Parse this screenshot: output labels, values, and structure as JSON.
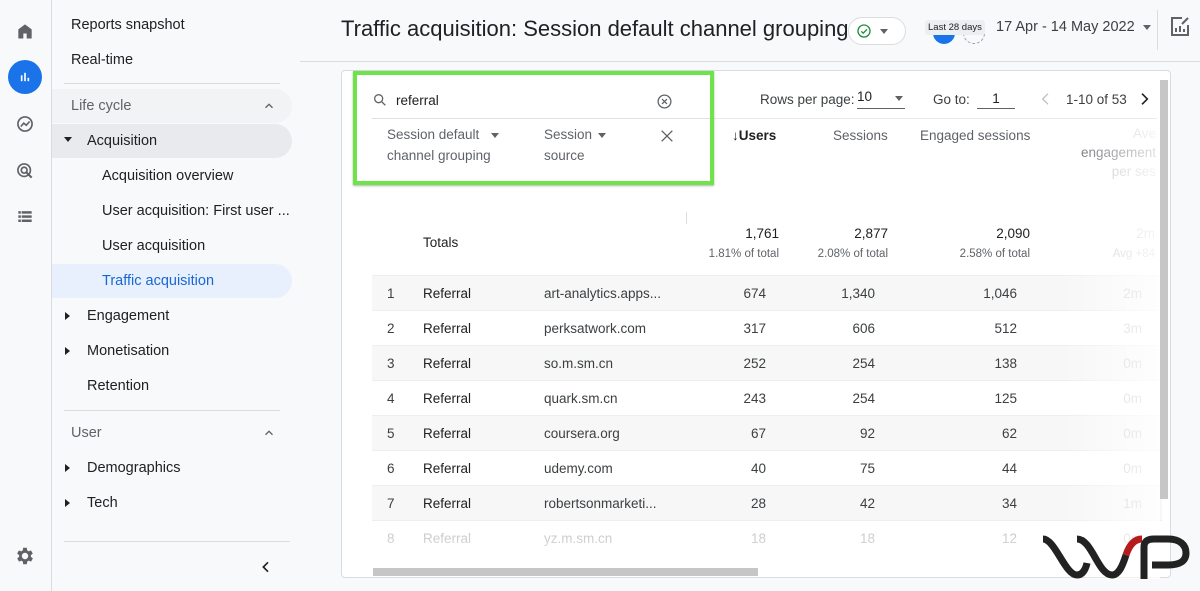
{
  "rail": {
    "icons": [
      "home-icon",
      "reports-icon",
      "explore-icon",
      "advertising-icon",
      "configure-icon"
    ],
    "settings_icon": "gear-icon"
  },
  "nav": {
    "reports_snapshot": "Reports snapshot",
    "realtime": "Real-time",
    "life_cycle": "Life cycle",
    "acquisition": "Acquisition",
    "acquisition_overview": "Acquisition overview",
    "user_acquisition_first": "User acquisition: First user ...",
    "user_acquisition": "User acquisition",
    "traffic_acquisition": "Traffic acquisition",
    "engagement": "Engagement",
    "monetisation": "Monetisation",
    "retention": "Retention",
    "user": "User",
    "demographics": "Demographics",
    "tech": "Tech"
  },
  "header": {
    "title": "Traffic acquisition: Session default channel grouping",
    "date_badge": "Last 28 days",
    "date_range": "17 Apr - 14 May 2022",
    "accent_color": "#1a73e8",
    "status_color": "#1e8e3e"
  },
  "table": {
    "search_value": "referral",
    "dimension_1": "Session default channel grouping",
    "dimension_1_line1": "Session default",
    "dimension_1_line2": "channel grouping",
    "dimension_2_line1": "Session",
    "dimension_2_line2": "source",
    "rows_per_page_label": "Rows per page:",
    "rows_per_page_value": "10",
    "goto_label": "Go to:",
    "goto_value": "1",
    "page_range": "1-10 of 53",
    "columns": {
      "users": "Users",
      "sessions": "Sessions",
      "engaged_sessions": "Engaged sessions",
      "avg_engagement_l1": "Ave",
      "avg_engagement_l2": "engagement",
      "avg_engagement_l3": "per ses"
    },
    "totals": {
      "label": "Totals",
      "users": "1,761",
      "users_pct": "1.81% of total",
      "sessions": "2,877",
      "sessions_pct": "2.08% of total",
      "engaged": "2,090",
      "engaged_pct": "2.58% of total",
      "avg": "2m",
      "avg_sub": "Avg +84"
    },
    "rows": [
      {
        "idx": "1",
        "channel": "Referral",
        "source": "art-analytics.apps...",
        "users": "674",
        "sessions": "1,340",
        "engaged": "1,046",
        "avg": "2m"
      },
      {
        "idx": "2",
        "channel": "Referral",
        "source": "perksatwork.com",
        "users": "317",
        "sessions": "606",
        "engaged": "512",
        "avg": "3m"
      },
      {
        "idx": "3",
        "channel": "Referral",
        "source": "so.m.sm.cn",
        "users": "252",
        "sessions": "254",
        "engaged": "138",
        "avg": "0m"
      },
      {
        "idx": "4",
        "channel": "Referral",
        "source": "quark.sm.cn",
        "users": "243",
        "sessions": "254",
        "engaged": "125",
        "avg": "0m"
      },
      {
        "idx": "5",
        "channel": "Referral",
        "source": "coursera.org",
        "users": "67",
        "sessions": "92",
        "engaged": "62",
        "avg": "0m"
      },
      {
        "idx": "6",
        "channel": "Referral",
        "source": "udemy.com",
        "users": "40",
        "sessions": "75",
        "engaged": "44",
        "avg": "0m"
      },
      {
        "idx": "7",
        "channel": "Referral",
        "source": "robertsonmarketi...",
        "users": "28",
        "sessions": "42",
        "engaged": "34",
        "avg": "1m"
      },
      {
        "idx": "8",
        "channel": "Referral",
        "source": "yz.m.sm.cn",
        "users": "18",
        "sessions": "18",
        "engaged": "12",
        "avg": "0m"
      }
    ],
    "highlight_color": "#6ee44a"
  },
  "watermark": {
    "logo": "wp-logo",
    "colors": [
      "#222222",
      "#b71c1c"
    ]
  }
}
